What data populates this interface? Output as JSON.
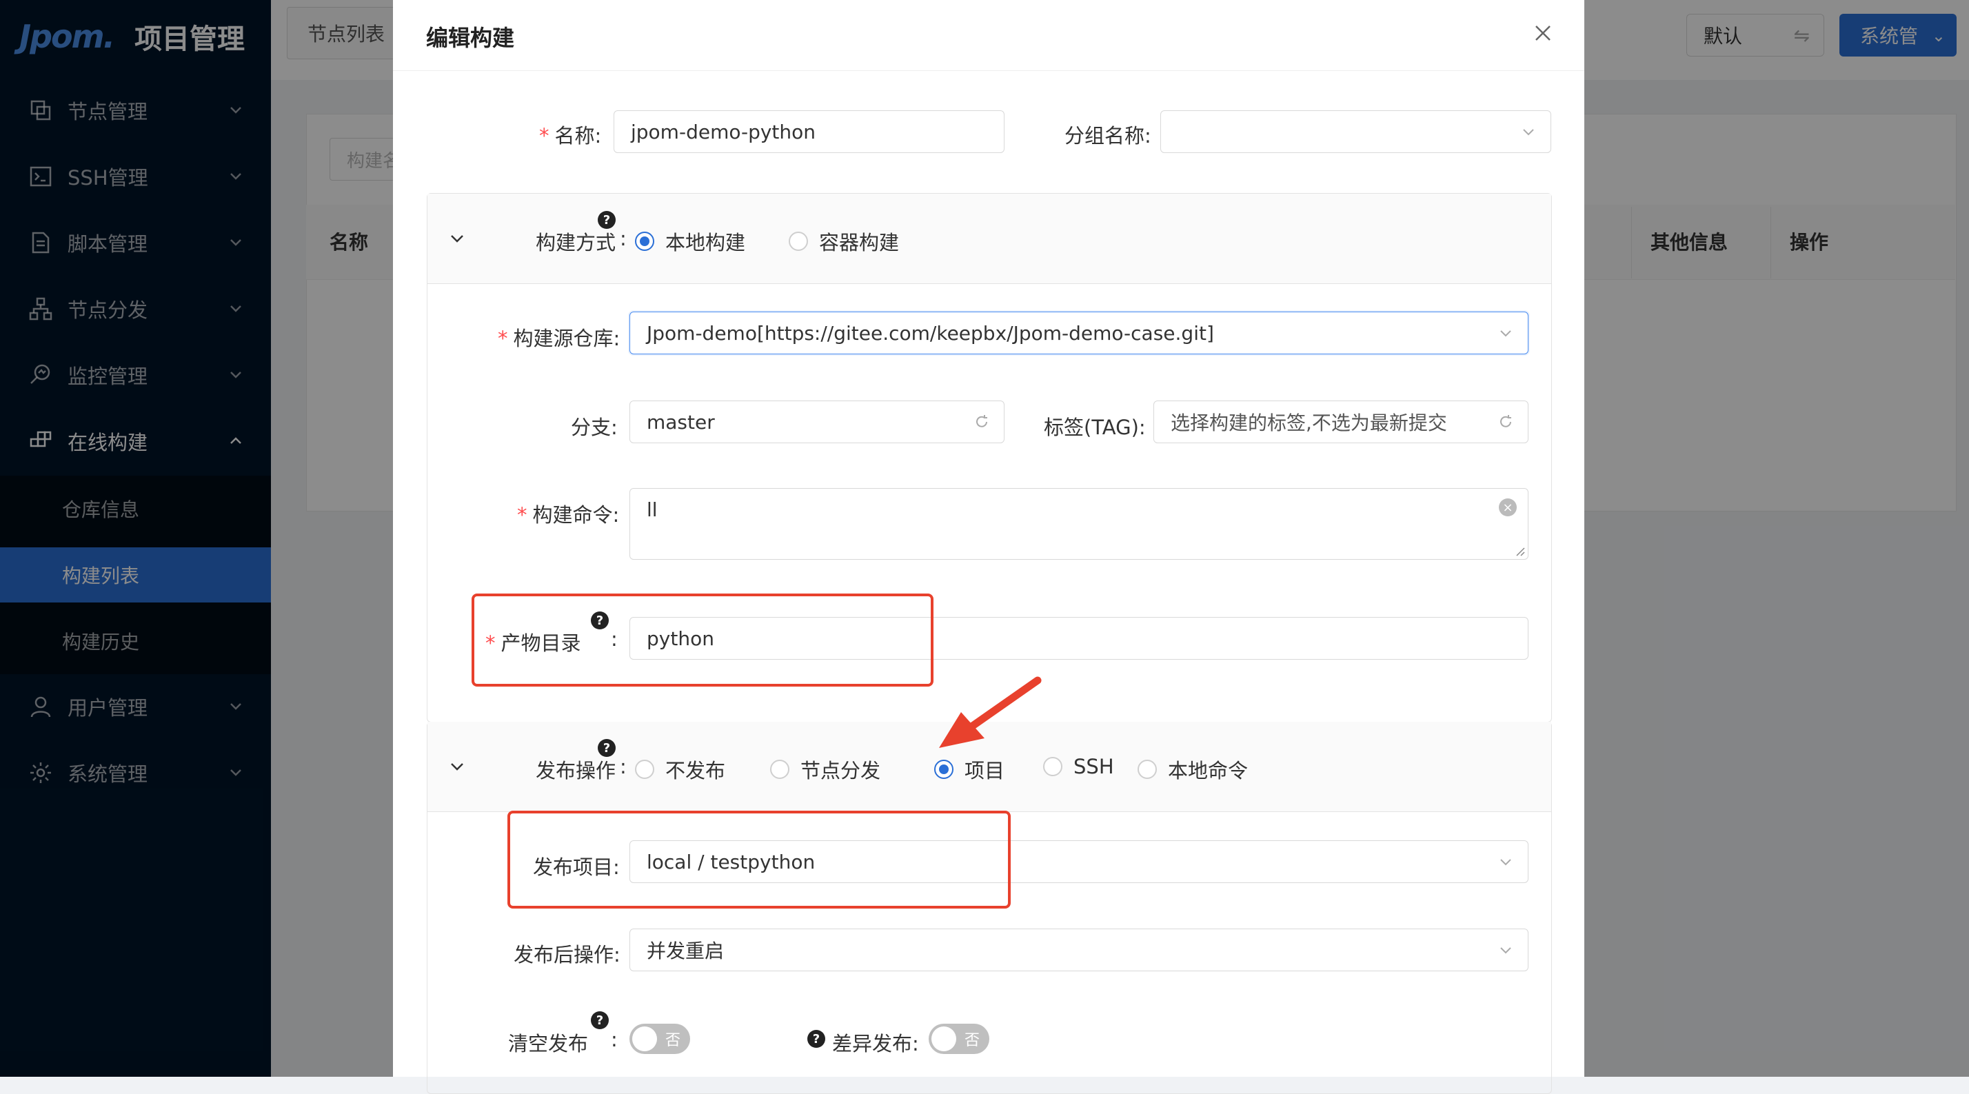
{
  "app": {
    "logo": "Jpom.",
    "title": "项目管理"
  },
  "sidebar": {
    "items": [
      {
        "label": "节点管理",
        "icon": "node-icon"
      },
      {
        "label": "SSH管理",
        "icon": "terminal-icon"
      },
      {
        "label": "脚本管理",
        "icon": "script-icon"
      },
      {
        "label": "节点分发",
        "icon": "distribute-icon"
      },
      {
        "label": "监控管理",
        "icon": "monitor-icon"
      },
      {
        "label": "在线构建",
        "icon": "build-icon"
      },
      {
        "label": "用户管理",
        "icon": "user-icon"
      },
      {
        "label": "系统管理",
        "icon": "gear-icon"
      }
    ],
    "submenu": [
      {
        "label": "仓库信息"
      },
      {
        "label": "构建列表"
      },
      {
        "label": "构建历史"
      }
    ]
  },
  "background": {
    "tab": "节点列表",
    "workspace": "默认",
    "user": "系统管",
    "search_placeholder": "构建名",
    "columns": {
      "name": "名称",
      "other": "其他信息",
      "ops": "操作"
    }
  },
  "modal": {
    "title": "编辑构建",
    "name": {
      "label": "名称",
      "value": "jpom-demo-python"
    },
    "group": {
      "label": "分组名称",
      "value": ""
    },
    "build_method": {
      "label": "构建方式",
      "options": [
        "本地构建",
        "容器构建"
      ],
      "selected": "本地构建"
    },
    "repo": {
      "label": "构建源仓库",
      "value": "Jpom-demo[https://gitee.com/keepbx/Jpom-demo-case.git]"
    },
    "branch": {
      "label": "分支",
      "value": "master"
    },
    "tag": {
      "label": "标签(TAG)",
      "placeholder": "选择构建的标签,不选为最新提交"
    },
    "command": {
      "label": "构建命令",
      "value": "ll"
    },
    "artifact": {
      "label": "产物目录",
      "value": "python"
    },
    "release_op": {
      "label": "发布操作",
      "options": [
        "不发布",
        "节点分发",
        "项目",
        "SSH",
        "本地命令"
      ],
      "selected": "项目"
    },
    "release_project": {
      "label": "发布项目",
      "value": "local / testpython"
    },
    "after_release": {
      "label": "发布后操作",
      "value": "并发重启"
    },
    "clear_release": {
      "label": "清空发布",
      "toggle_text": "否"
    },
    "diff_release": {
      "label": "差异发布",
      "toggle_text": "否"
    }
  },
  "colors": {
    "sidebar_bg": "#001529",
    "accent": "#2b6fd6",
    "highlight": "#e8412d",
    "required": "#ff4d4f"
  }
}
